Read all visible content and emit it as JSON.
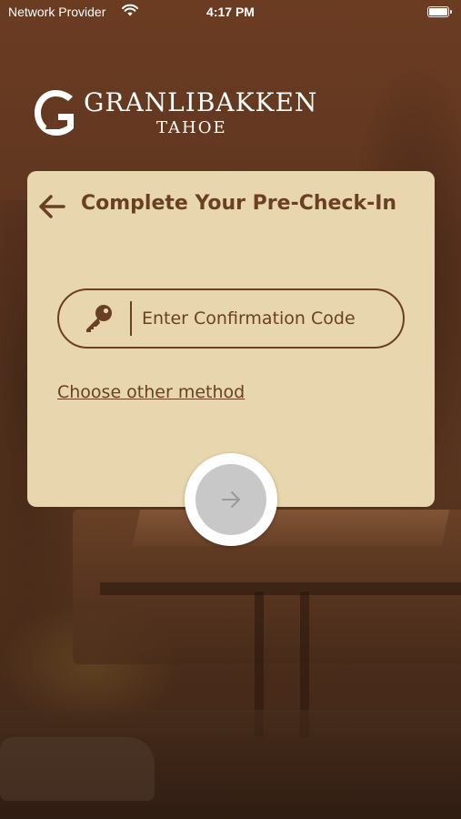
{
  "status_bar": {
    "carrier": "Network Provider",
    "time": "4:17 PM",
    "icons": [
      "wifi-icon",
      "battery-icon"
    ]
  },
  "logo": {
    "name": "GRANLIBAKKEN",
    "subtitle": "TAHOE",
    "mark_icon": "granlibakken-g-mark"
  },
  "card": {
    "title": "Complete Your Pre-Check-In",
    "back_icon": "arrow-left-icon",
    "code_field": {
      "icon": "key-icon",
      "value": "",
      "placeholder": "Enter Confirmation Code"
    },
    "other_method_link": "Choose other method"
  },
  "submit": {
    "icon": "arrow-right-icon",
    "state": "disabled"
  },
  "colors": {
    "card_background": "#e8d7ae",
    "primary_brown": "#6a3f24",
    "submit_disabled": "#c8c8c8",
    "background_tint": "#5e3520"
  }
}
